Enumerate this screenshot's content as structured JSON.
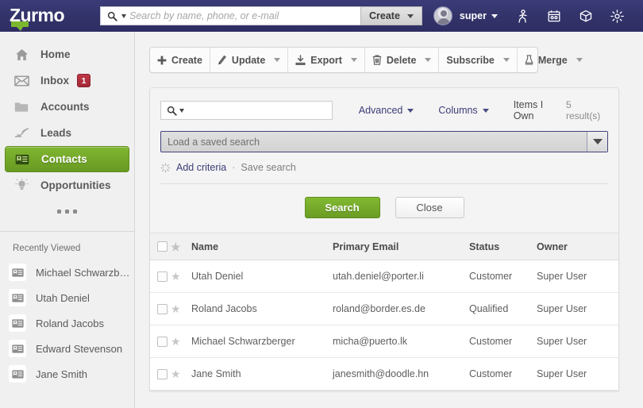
{
  "header": {
    "logo_text": "Zurmo",
    "search_placeholder": "Search by name, phone, or e-mail",
    "search_value": "",
    "create_label": "Create",
    "username": "super",
    "icons": [
      "person-walking-icon",
      "calendar-icon",
      "gift-box-icon",
      "gear-icon"
    ]
  },
  "sidebar": {
    "items": [
      {
        "label": "Home",
        "icon": "home-icon",
        "active": false,
        "badge": null
      },
      {
        "label": "Inbox",
        "icon": "envelope-icon",
        "active": false,
        "badge": "1"
      },
      {
        "label": "Accounts",
        "icon": "folder-icon",
        "active": false,
        "badge": null
      },
      {
        "label": "Leads",
        "icon": "leads-icon",
        "active": false,
        "badge": null
      },
      {
        "label": "Contacts",
        "icon": "contact-card-icon",
        "active": true,
        "badge": null
      },
      {
        "label": "Opportunities",
        "icon": "lightbulb-icon",
        "active": false,
        "badge": null
      }
    ],
    "more_label": "more-menu",
    "recently_viewed_title": "Recently Viewed",
    "recently_viewed": [
      {
        "label": "Michael Schwarzb…",
        "icon": "contact-card-icon"
      },
      {
        "label": "Utah Deniel",
        "icon": "contact-card-icon"
      },
      {
        "label": "Roland Jacobs",
        "icon": "contact-card-icon"
      },
      {
        "label": "Edward Stevenson",
        "icon": "contact-card-icon"
      },
      {
        "label": "Jane Smith",
        "icon": "contact-card-icon"
      }
    ]
  },
  "toolbar": {
    "buttons": [
      {
        "label": "Create",
        "icon": "plus-icon",
        "has_caret": false
      },
      {
        "label": "Update",
        "icon": "pencil-icon",
        "has_caret": true
      },
      {
        "label": "Export",
        "icon": "export-icon",
        "has_caret": true
      },
      {
        "label": "Delete",
        "icon": "trash-icon",
        "has_caret": true
      },
      {
        "label": "Subscribe",
        "icon": null,
        "has_caret": true
      },
      {
        "label": "Merge",
        "icon": "merge-flask-icon",
        "has_caret": true
      }
    ]
  },
  "search_panel": {
    "search_input_value": "",
    "search_icon": "magnifier-icon",
    "advanced_label": "Advanced",
    "columns_label": "Columns",
    "items_i_own_label": "Items I Own",
    "result_count": "5 result(s)",
    "saved_search_placeholder": "Load a saved search",
    "add_criteria_label": "Add criteria",
    "separator": "·",
    "save_search_label": "Save search",
    "search_button_label": "Search",
    "close_button_label": "Close"
  },
  "table": {
    "columns": [
      "Name",
      "Primary Email",
      "Status",
      "Owner"
    ],
    "rows": [
      {
        "name": "Utah Deniel",
        "email": "utah.deniel@porter.li",
        "status": "Customer",
        "owner": "Super User"
      },
      {
        "name": "Roland Jacobs",
        "email": "roland@border.es.de",
        "status": "Qualified",
        "owner": "Super User"
      },
      {
        "name": "Michael Schwarzberger",
        "email": "micha@puerto.lk",
        "status": "Customer",
        "owner": "Super User"
      },
      {
        "name": "Jane Smith",
        "email": "janesmith@doodle.hn",
        "status": "Customer",
        "owner": "Super User"
      }
    ]
  },
  "colors": {
    "header_blue": "#33336b",
    "accent_green": "#74a929",
    "badge_red": "#a32836",
    "link_navy": "#3c3c78"
  }
}
